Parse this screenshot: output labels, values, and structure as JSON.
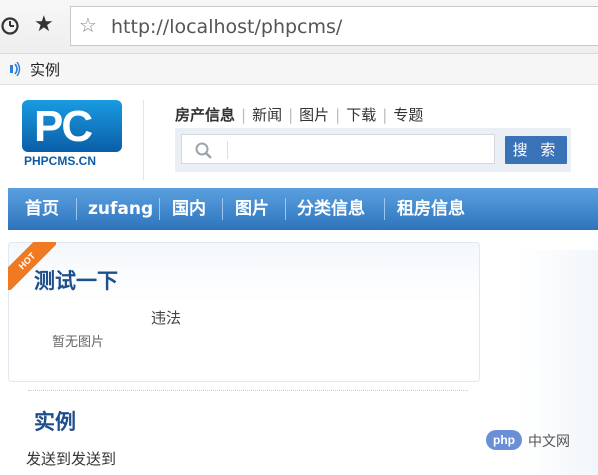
{
  "browser": {
    "url": "http://localhost/phpcms/",
    "bookmark_label": "实例"
  },
  "header": {
    "logo_text": "PHPCMS.CN",
    "logo_letters": "PC",
    "topnav": [
      "房产信息",
      "新闻",
      "图片",
      "下载",
      "专题"
    ],
    "search": {
      "value": "",
      "button_label": "搜 索"
    }
  },
  "mainnav": [
    "首页",
    "zufang",
    "国内",
    "图片",
    "分类信息",
    "租房信息"
  ],
  "content": {
    "hot_badge": "HOT",
    "article_title": "测试一下",
    "article_text": "违法",
    "no_image_text": "暂无图片",
    "section_title": "实例",
    "section_text": "发送到发送到"
  },
  "watermark": {
    "logo": "php",
    "text": "中文网"
  },
  "colors": {
    "nav_blue": "#3a7fc6",
    "title_blue": "#1f4e8c",
    "hot_orange": "#f07a24"
  }
}
